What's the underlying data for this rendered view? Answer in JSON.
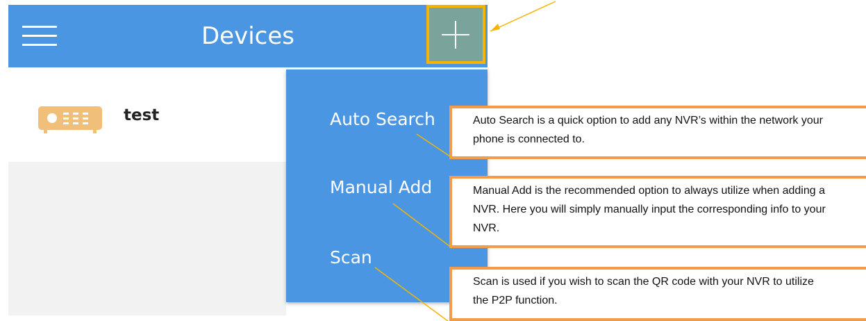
{
  "appbar": {
    "title": "Devices",
    "menu_icon": "hamburger-menu-icon",
    "add_icon": "plus-icon",
    "color": "#4b96e3",
    "highlight_color": "#f5b400"
  },
  "devices": [
    {
      "name": "test",
      "icon": "nvr-recorder-icon",
      "icon_color": "#f0c07a"
    }
  ],
  "add_menu": {
    "items": [
      {
        "label": "Auto Search"
      },
      {
        "label": "Manual Add"
      },
      {
        "label": "Scan"
      }
    ]
  },
  "callouts": [
    {
      "text": "Auto Search is a quick option to add any NVR’s within the network your phone is connected to."
    },
    {
      "text": "Manual Add is the recommended option to always utilize when adding a NVR.  Here you will simply manually input the corresponding info to your NVR."
    },
    {
      "text": "Scan is used if you wish to scan the QR code with your NVR to utilize the P2P function."
    }
  ],
  "colors": {
    "callout_border": "#f39b4a",
    "leader_line": "#f5b400"
  }
}
